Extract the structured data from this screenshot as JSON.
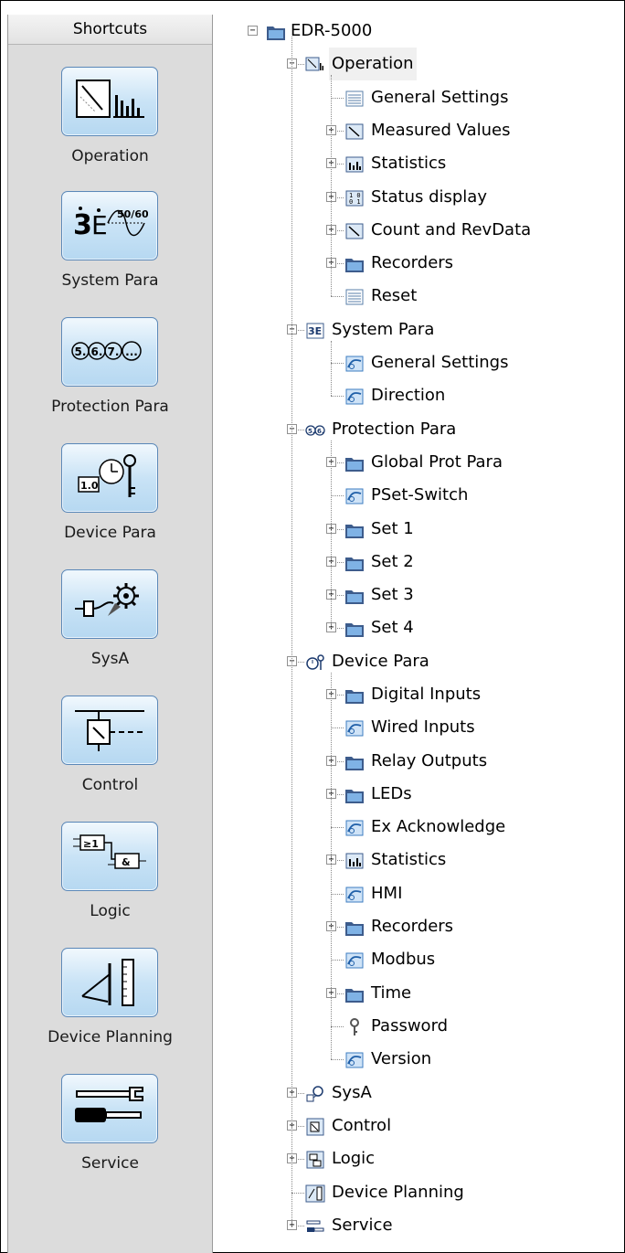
{
  "sidebar": {
    "title": "Shortcuts",
    "items": [
      {
        "label": "Operation",
        "icon": "operation-meter-icon"
      },
      {
        "label": "System Para",
        "icon": "system-para-wave-icon"
      },
      {
        "label": "Protection Para",
        "icon": "protection-para-numbers-icon"
      },
      {
        "label": "Device Para",
        "icon": "device-para-clock-key-icon"
      },
      {
        "label": "SysA",
        "icon": "sysa-gear-plug-icon"
      },
      {
        "label": "Control",
        "icon": "control-switch-icon"
      },
      {
        "label": "Logic",
        "icon": "logic-gates-icon"
      },
      {
        "label": "Device Planning",
        "icon": "device-planning-ruler-icon"
      },
      {
        "label": "Service",
        "icon": "service-tools-icon"
      }
    ]
  },
  "tree": {
    "root": "EDR-5000",
    "nodes": [
      {
        "label": "Operation",
        "level": 1,
        "icon": "operation-icon",
        "expander": "-",
        "selected": true
      },
      {
        "label": "General Settings",
        "level": 2,
        "icon": "list-icon",
        "expander": ""
      },
      {
        "label": "Measured Values",
        "level": 2,
        "icon": "meter-icon",
        "expander": "+"
      },
      {
        "label": "Statistics",
        "level": 2,
        "icon": "statistics-icon",
        "expander": "+"
      },
      {
        "label": "Status display",
        "level": 2,
        "icon": "binary-icon",
        "expander": "+"
      },
      {
        "label": "Count and RevData",
        "level": 2,
        "icon": "meter-icon",
        "expander": "+"
      },
      {
        "label": "Recorders",
        "level": 2,
        "icon": "folder-icon",
        "expander": "+"
      },
      {
        "label": "Reset",
        "level": 2,
        "icon": "list-icon",
        "expander": ""
      },
      {
        "label": "System Para",
        "level": 1,
        "icon": "system-para-icon",
        "expander": "-"
      },
      {
        "label": "General Settings",
        "level": 2,
        "icon": "settings-curve-icon",
        "expander": ""
      },
      {
        "label": "Direction",
        "level": 2,
        "icon": "settings-curve-icon",
        "expander": ""
      },
      {
        "label": "Protection Para",
        "level": 1,
        "icon": "protection-icon",
        "expander": "-"
      },
      {
        "label": "Global Prot Para",
        "level": 2,
        "icon": "folder-icon",
        "expander": "+"
      },
      {
        "label": "PSet-Switch",
        "level": 2,
        "icon": "settings-curve-icon",
        "expander": ""
      },
      {
        "label": "Set 1",
        "level": 2,
        "icon": "folder-icon",
        "expander": "+"
      },
      {
        "label": "Set 2",
        "level": 2,
        "icon": "folder-icon",
        "expander": "+"
      },
      {
        "label": "Set 3",
        "level": 2,
        "icon": "folder-icon",
        "expander": "+"
      },
      {
        "label": "Set 4",
        "level": 2,
        "icon": "folder-icon",
        "expander": "+"
      },
      {
        "label": "Device Para",
        "level": 1,
        "icon": "device-para-icon",
        "expander": "-"
      },
      {
        "label": "Digital Inputs",
        "level": 2,
        "icon": "folder-icon",
        "expander": "+"
      },
      {
        "label": "Wired Inputs",
        "level": 2,
        "icon": "settings-curve-icon",
        "expander": ""
      },
      {
        "label": "Relay Outputs",
        "level": 2,
        "icon": "folder-icon",
        "expander": "+"
      },
      {
        "label": "LEDs",
        "level": 2,
        "icon": "folder-icon",
        "expander": "+"
      },
      {
        "label": "Ex Acknowledge",
        "level": 2,
        "icon": "settings-curve-icon",
        "expander": ""
      },
      {
        "label": "Statistics",
        "level": 2,
        "icon": "statistics-icon",
        "expander": "+"
      },
      {
        "label": "HMI",
        "level": 2,
        "icon": "settings-curve-icon",
        "expander": ""
      },
      {
        "label": "Recorders",
        "level": 2,
        "icon": "folder-icon",
        "expander": "+"
      },
      {
        "label": "Modbus",
        "level": 2,
        "icon": "settings-curve-icon",
        "expander": ""
      },
      {
        "label": "Time",
        "level": 2,
        "icon": "folder-icon",
        "expander": "+"
      },
      {
        "label": "Password",
        "level": 2,
        "icon": "key-icon",
        "expander": ""
      },
      {
        "label": "Version",
        "level": 2,
        "icon": "settings-curve-icon",
        "expander": ""
      },
      {
        "label": "SysA",
        "level": 1,
        "icon": "sysa-icon",
        "expander": "+"
      },
      {
        "label": "Control",
        "level": 1,
        "icon": "control-icon",
        "expander": "+"
      },
      {
        "label": "Logic",
        "level": 1,
        "icon": "logic-icon",
        "expander": "+"
      },
      {
        "label": "Device Planning",
        "level": 1,
        "icon": "planning-icon",
        "expander": ""
      },
      {
        "label": "Service",
        "level": 1,
        "icon": "service-icon",
        "expander": "+"
      }
    ]
  }
}
